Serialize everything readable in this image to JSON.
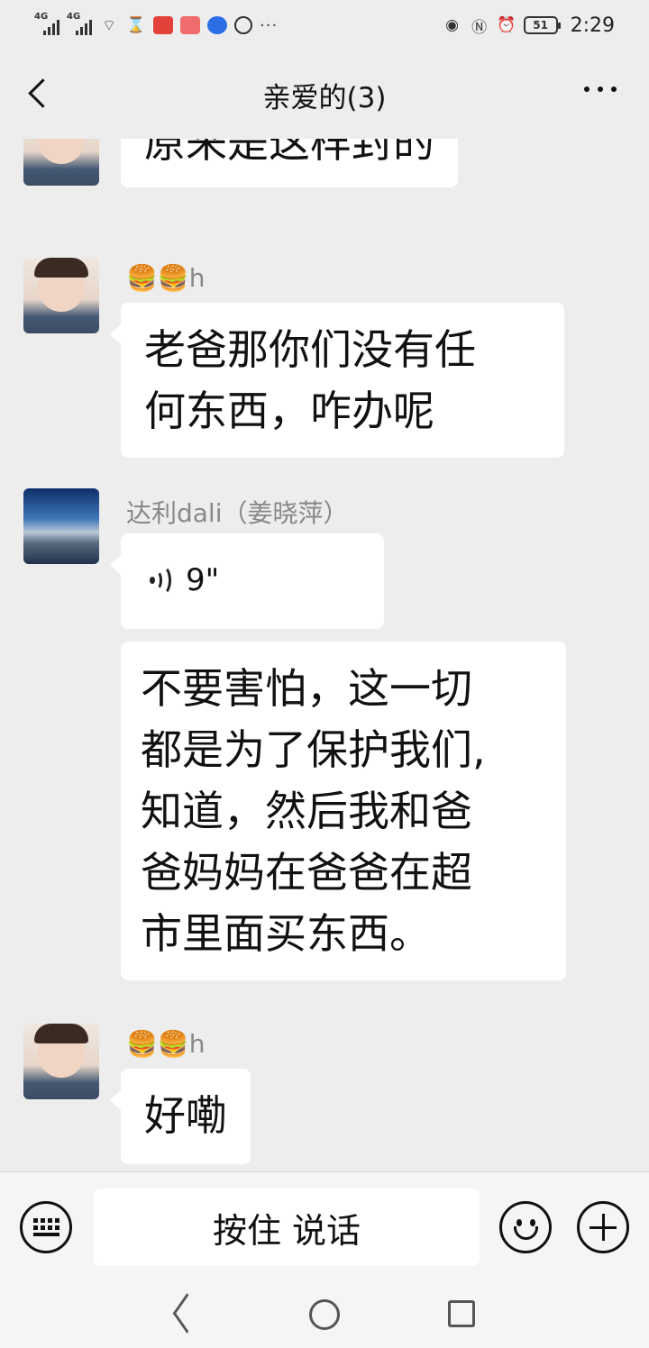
{
  "status_bar": {
    "network_1": "4G",
    "network_2": "4G",
    "battery": "51",
    "time": "2:29"
  },
  "header": {
    "title": "亲爱的(3)"
  },
  "messages": [
    {
      "sender": "",
      "type": "text",
      "text": "原来是这样封的"
    },
    {
      "sender": "🍔🍔h",
      "type": "text",
      "lines": [
        "老爸那你们没有任",
        "何东西，咋办呢"
      ]
    },
    {
      "sender": "达利dali（姜晓萍）",
      "type": "voice",
      "duration": "9\""
    },
    {
      "sender": "",
      "type": "text",
      "lines": [
        "不要害怕，这一切",
        "都是为了保护我们,",
        "知道，然后我和爸",
        "爸妈妈在爸爸在超",
        "市里面买东西。"
      ]
    },
    {
      "sender": "🍔🍔h",
      "type": "text",
      "text": "好嘞"
    }
  ],
  "input_bar": {
    "hold_to_talk_label": "按住 说话"
  },
  "icons": {
    "back": "chevron-left-icon",
    "more": "more-dots-icon",
    "keyboard": "keyboard-icon",
    "emoji": "emoji-icon",
    "plus": "plus-icon",
    "voice": "voice-wave-icon"
  }
}
